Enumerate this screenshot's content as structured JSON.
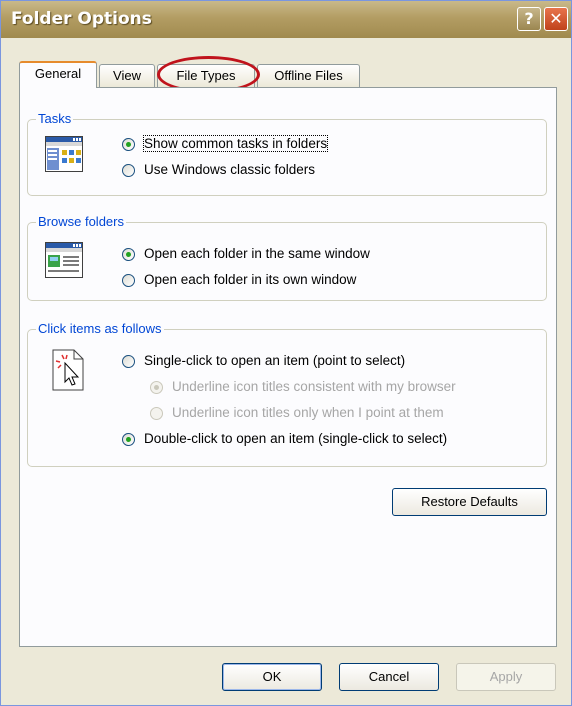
{
  "window": {
    "title": "Folder Options",
    "help_symbol": "?",
    "close_symbol": "✕"
  },
  "tabs": [
    {
      "label": "General"
    },
    {
      "label": "View"
    },
    {
      "label": "File Types"
    },
    {
      "label": "Offline Files"
    }
  ],
  "tasks": {
    "label": "Tasks",
    "options": [
      {
        "label": "Show common tasks in folders",
        "selected": true
      },
      {
        "label": "Use Windows classic folders",
        "selected": false
      }
    ]
  },
  "browse": {
    "label": "Browse folders",
    "options": [
      {
        "label": "Open each folder in the same window",
        "selected": true
      },
      {
        "label": "Open each folder in its own window",
        "selected": false
      }
    ]
  },
  "click": {
    "label": "Click items as follows",
    "options": [
      {
        "label": "Single-click to open an item (point to select)",
        "selected": false
      },
      {
        "label": "Underline icon titles consistent with my browser",
        "selected": true,
        "disabled": true
      },
      {
        "label": "Underline icon titles only when I point at them",
        "selected": false,
        "disabled": true
      },
      {
        "label": "Double-click to open an item (single-click to select)",
        "selected": true
      }
    ]
  },
  "buttons": {
    "restore": "Restore Defaults",
    "ok": "OK",
    "cancel": "Cancel",
    "apply": "Apply"
  },
  "colors": {
    "titlebar": "#b39d63",
    "annotation": "#c0131c",
    "group_label": "#0046d5"
  }
}
